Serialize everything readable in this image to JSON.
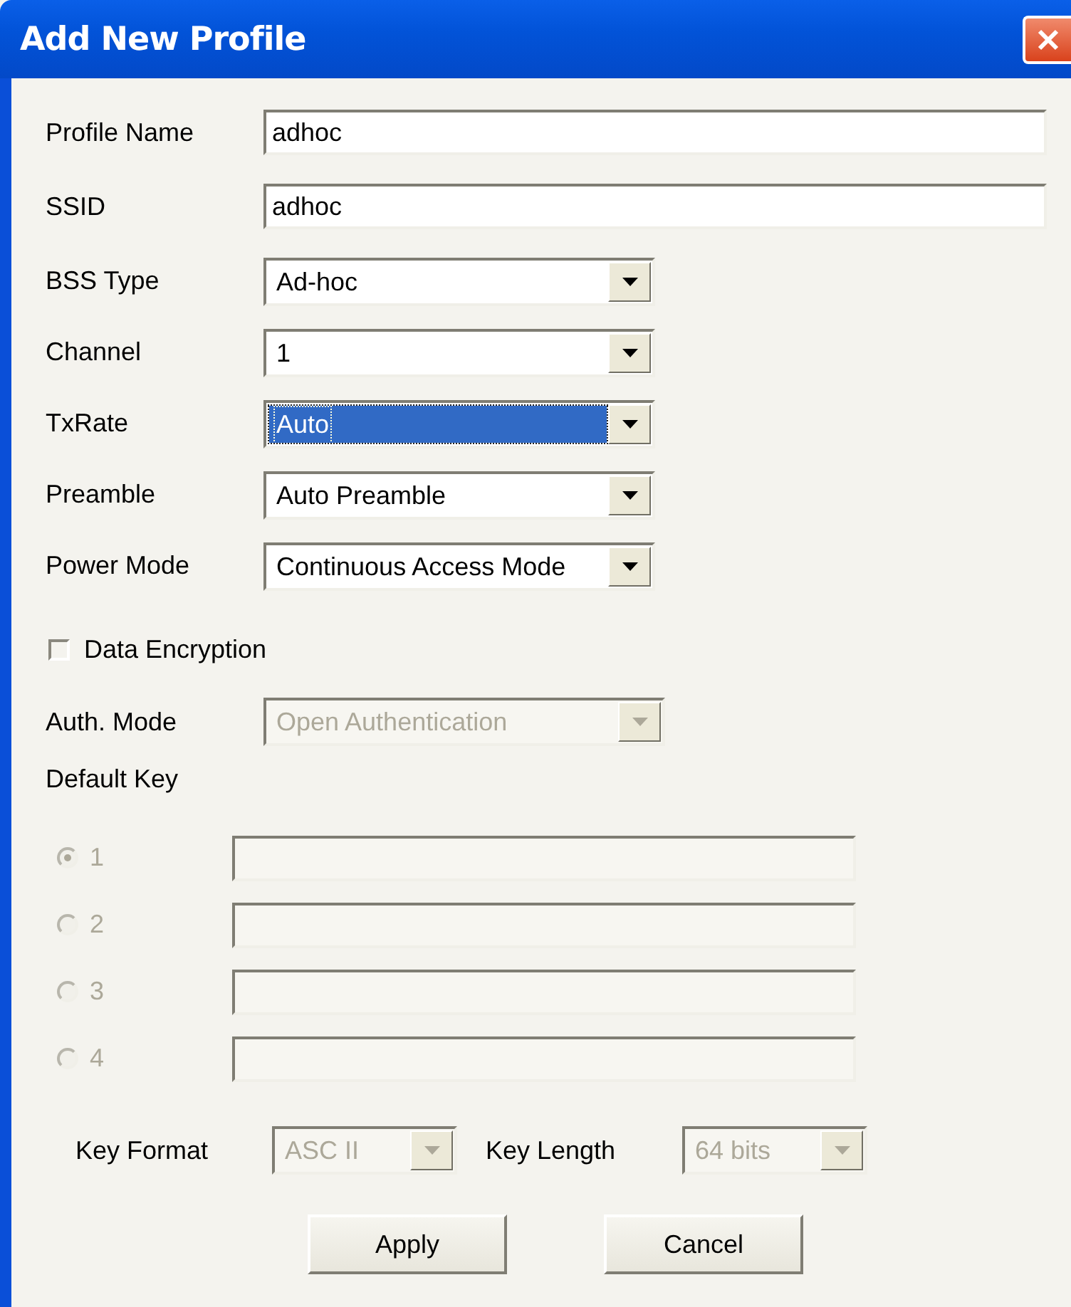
{
  "window": {
    "title": "Add New Profile"
  },
  "fields": [
    {
      "kind": "text",
      "label": "Profile Name",
      "value": "adhoc"
    },
    {
      "kind": "text",
      "label": "SSID",
      "value": "adhoc"
    },
    {
      "kind": "dropdown",
      "label": "BSS Type",
      "value": "Ad-hoc",
      "focused": false
    },
    {
      "kind": "dropdown",
      "label": "Channel",
      "value": "1",
      "focused": false
    },
    {
      "kind": "dropdown",
      "label": "TxRate",
      "value": "Auto",
      "focused": true
    },
    {
      "kind": "dropdown",
      "label": "Preamble",
      "value": "Auto Preamble",
      "focused": false
    },
    {
      "kind": "dropdown",
      "label": "Power Mode",
      "value": "Continuous Access Mode",
      "focused": false
    }
  ],
  "data_encryption": {
    "label": "Data Encryption",
    "checked": false
  },
  "auth_mode": {
    "label": "Auth. Mode",
    "value": "Open Authentication",
    "disabled": true
  },
  "default_key": {
    "label": "Default Key",
    "keys": [
      {
        "label": "1",
        "selected": true,
        "disabled": true
      },
      {
        "label": "2",
        "selected": false,
        "disabled": true
      },
      {
        "label": "3",
        "selected": false,
        "disabled": true
      },
      {
        "label": "4",
        "selected": false,
        "disabled": true
      }
    ]
  },
  "key_format": {
    "label": "Key Format",
    "value": "ASC II",
    "disabled": true
  },
  "key_length": {
    "label": "Key Length",
    "value": "64 bits",
    "disabled": true
  },
  "buttons": [
    "Apply",
    "Cancel"
  ]
}
